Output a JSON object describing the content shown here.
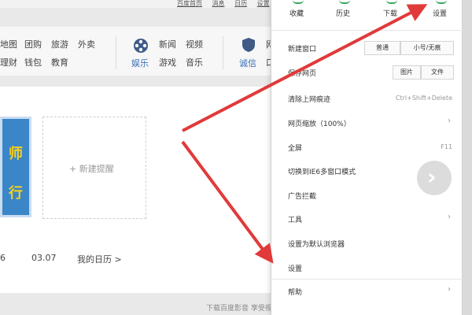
{
  "toplinks": [
    "百度首页",
    "消息",
    "日历",
    "设置"
  ],
  "nav": {
    "row1": [
      "地图",
      "团购",
      "旅游",
      "外卖"
    ],
    "row2": [
      "理财",
      "钱包",
      "教育"
    ],
    "film_label": "娱乐",
    "mid_row1": [
      "新闻",
      "视频"
    ],
    "mid_row2": [
      "游戏",
      "音乐"
    ],
    "shield_label": "诚信",
    "right_row1": "网",
    "right_row2": "口"
  },
  "card": {
    "thumb_line1": "师",
    "thumb_line2": "行",
    "reminder": "+ 新建提醒",
    "date1": "6",
    "date2": "03.07",
    "calendar_link": "我的日历 >",
    "footer": "下载百度影音 享受视听盛宴"
  },
  "menu": {
    "icons": [
      "收藏",
      "历史",
      "下载",
      "设置"
    ],
    "new_window": "新建窗口",
    "normal_btn": "普通",
    "small_btn": "小号/无痕",
    "save_page": "保存网页",
    "image_btn": "图片",
    "file_btn": "文件",
    "clear_traces": "清除上网痕迹",
    "clear_shortcut": "Ctrl+Shift+Delete",
    "zoom": "网页缩放（100%）",
    "fullscreen": "全屏",
    "fullscreen_shortcut": "F11",
    "ie6": "切换到IE6多窗口模式",
    "adblock": "广告拦截",
    "tools": "工具",
    "default_browser": "设置为默认浏览器",
    "settings": "设置",
    "help": "帮助"
  },
  "colors": {
    "arrow": "#e03a3a",
    "accent": "#39a85c",
    "link": "#3a6fb5"
  }
}
